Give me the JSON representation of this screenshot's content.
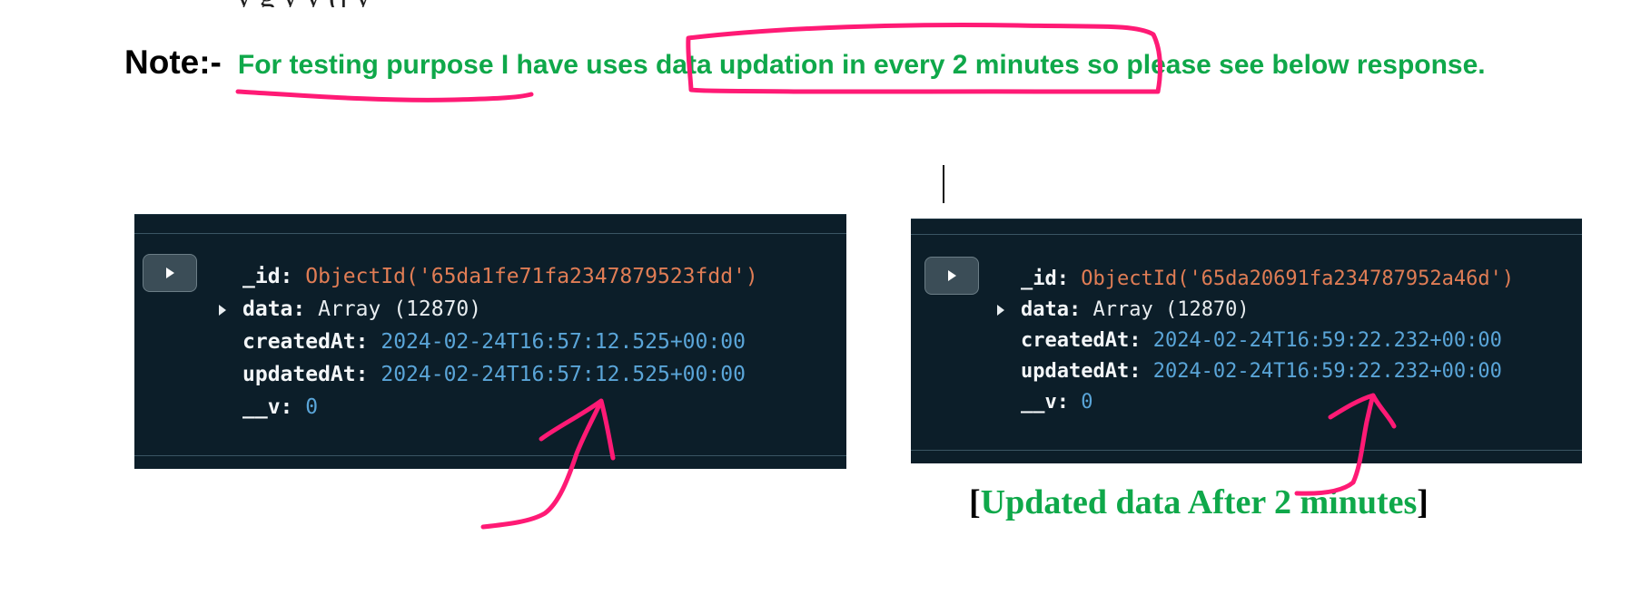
{
  "top_cut_text": "y                         g y   y           (j          y",
  "note": {
    "label": "Note:-",
    "text": "For testing purpose I have uses data updation in every 2 minutes so please see below response."
  },
  "documents": [
    {
      "id_key": "_id:",
      "id_value": "ObjectId('65da1fe71fa2347879523fdd')",
      "data_key": "data:",
      "data_value": "Array (12870)",
      "created_key": "createdAt:",
      "created_value": "2024-02-24T16:57:12.525+00:00",
      "updated_key": "updatedAt:",
      "updated_value": "2024-02-24T16:57:12.525+00:00",
      "v_key": "__v:",
      "v_value": "0"
    },
    {
      "id_key": "_id:",
      "id_value": "ObjectId('65da20691fa234787952a46d')",
      "data_key": "data:",
      "data_value": "Array (12870)",
      "created_key": "createdAt:",
      "created_value": "2024-02-24T16:59:22.232+00:00",
      "updated_key": "updatedAt:",
      "updated_value": "2024-02-24T16:59:22.232+00:00",
      "v_key": "__v:",
      "v_value": "0"
    }
  ],
  "caption": {
    "open": "[",
    "text": "Updated data After 2 minutes",
    "close": "]"
  },
  "colors": {
    "green": "#0fa84a",
    "annotation_pink": "#ff1a75",
    "panel_bg": "#0c1e29",
    "objectid": "#e07d55",
    "date": "#5aa5d8"
  },
  "icons": [
    "play-icon",
    "expand-triangle-icon"
  ]
}
